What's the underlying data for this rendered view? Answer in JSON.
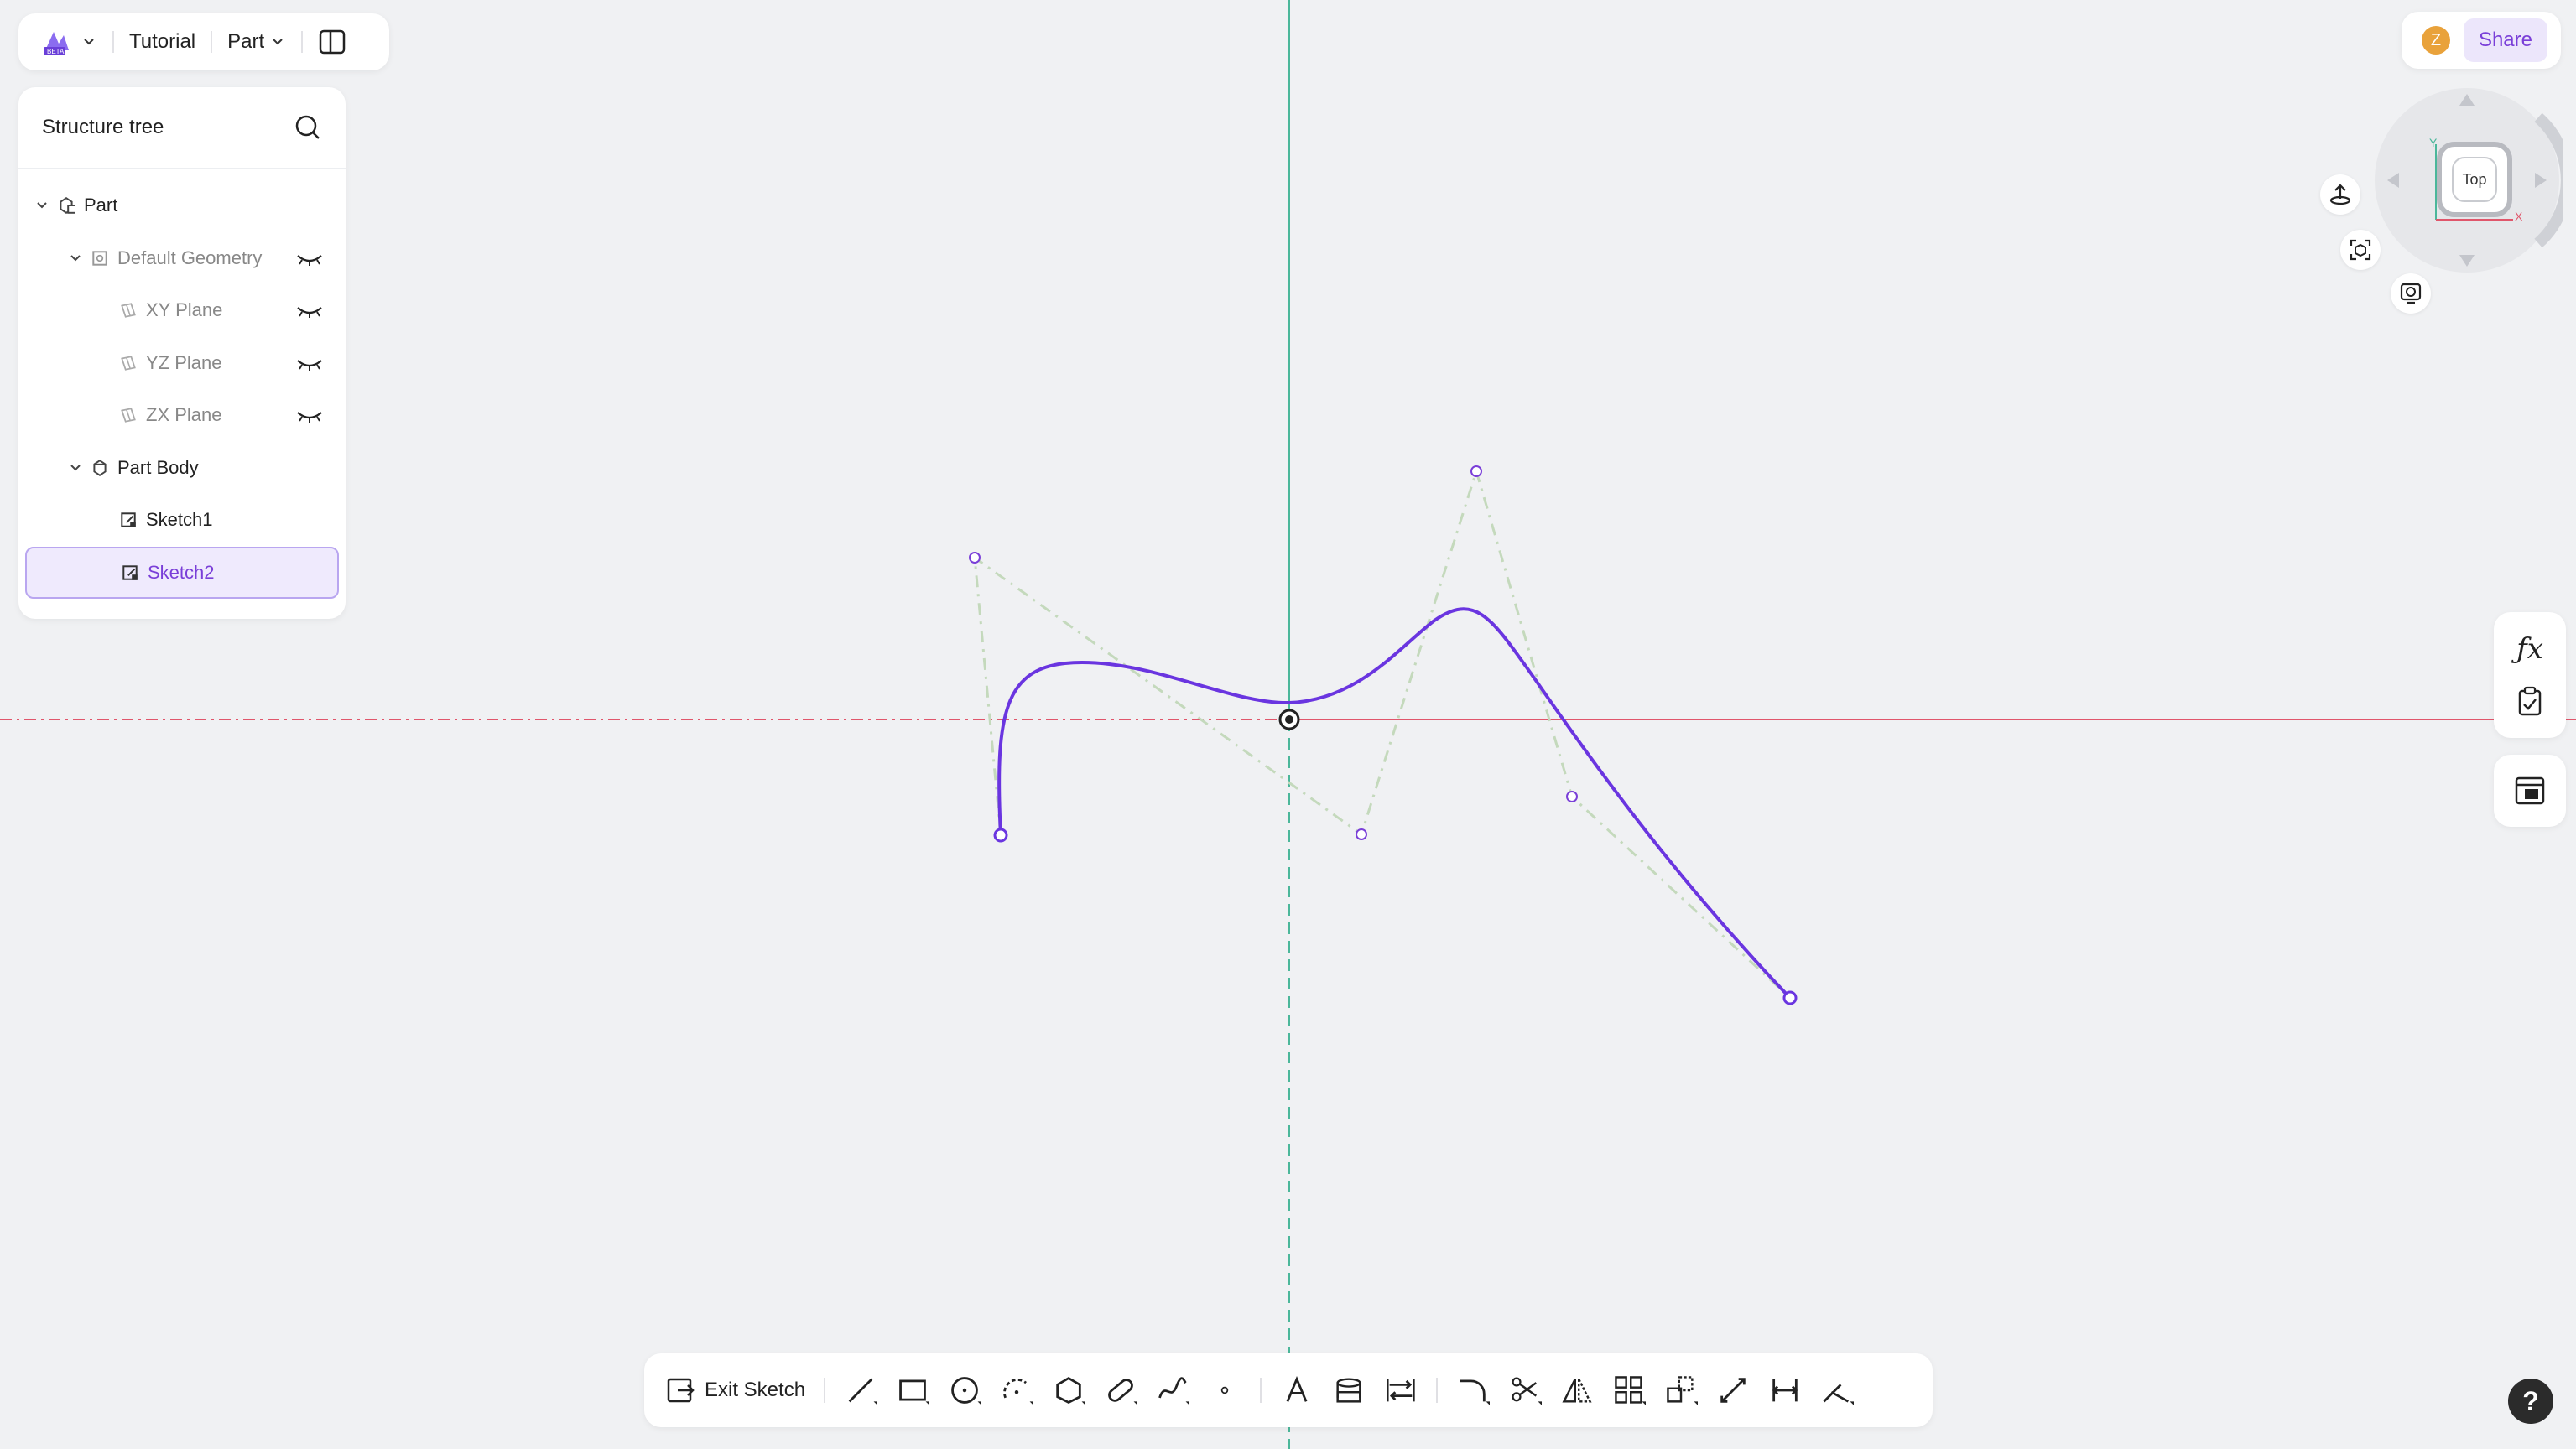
{
  "header": {
    "project": "Tutorial",
    "mode": "Part"
  },
  "tree": {
    "title": "Structure tree",
    "items": [
      {
        "label": "Part",
        "level": 0,
        "expanded": true,
        "faded": false,
        "eye": false,
        "selected": false,
        "icon": "part-icon"
      },
      {
        "label": "Default Geometry",
        "level": 1,
        "expanded": true,
        "faded": true,
        "eye": true,
        "selected": false,
        "icon": "geometry-icon"
      },
      {
        "label": "XY Plane",
        "level": 2,
        "faded": true,
        "eye": true,
        "selected": false,
        "icon": "plane-icon"
      },
      {
        "label": "YZ Plane",
        "level": 2,
        "faded": true,
        "eye": true,
        "selected": false,
        "icon": "plane-icon"
      },
      {
        "label": "ZX Plane",
        "level": 2,
        "faded": true,
        "eye": true,
        "selected": false,
        "icon": "plane-icon"
      },
      {
        "label": "Part Body",
        "level": 1,
        "expanded": true,
        "faded": false,
        "eye": false,
        "selected": false,
        "icon": "body-icon"
      },
      {
        "label": "Sketch1",
        "level": 2,
        "faded": false,
        "eye": false,
        "selected": false,
        "icon": "sketch-icon"
      },
      {
        "label": "Sketch2",
        "level": 2,
        "faded": false,
        "eye": false,
        "selected": true,
        "icon": "sketch-icon"
      }
    ]
  },
  "user": {
    "initial": "Z",
    "share_label": "Share"
  },
  "view": {
    "cube_label": "Top",
    "axis_x": "X",
    "axis_y": "Y"
  },
  "toolbar": {
    "exit_label": "Exit Sketch",
    "tools": [
      "line-tool-icon",
      "rectangle-tool-icon",
      "circle-tool-icon",
      "arc-tool-icon",
      "polygon-tool-icon",
      "slot-tool-icon",
      "spline-tool-icon",
      "point-tool-icon",
      "text-tool-icon",
      "project-tool-icon",
      "convert-tool-icon",
      "fillet-tool-icon",
      "trim-tool-icon",
      "mirror-tool-icon",
      "pattern-tool-icon",
      "transform-tool-icon",
      "dimension-tool-icon",
      "distance-tool-icon",
      "constraint-tool-icon"
    ]
  },
  "colors": {
    "accent": "#7a3fd8",
    "x_axis": "#e0566b",
    "y_axis": "#4bb79a",
    "spline": "#6a35e0",
    "control": "#b8d4b0"
  },
  "help_label": "?"
}
